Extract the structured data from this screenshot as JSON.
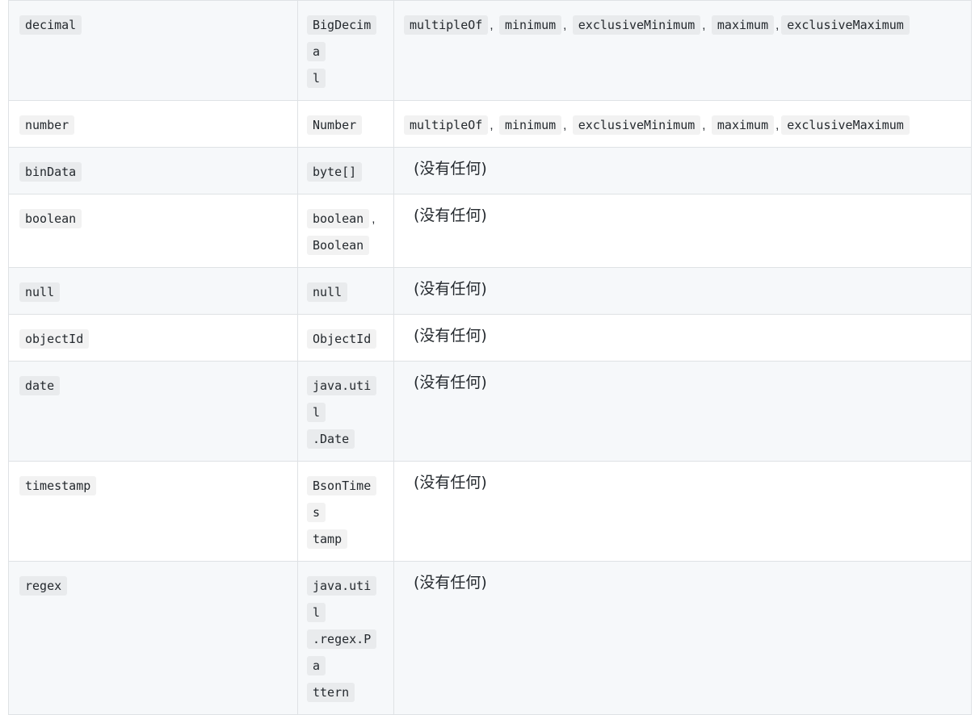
{
  "rows": [
    {
      "bson": "decimal",
      "java": "BigDecimal",
      "java_parts": [
        "BigDecima",
        "l"
      ],
      "validators": [
        "multipleOf",
        "minimum",
        "exclusiveMinimum",
        "maximum",
        "exclusiveMaximum"
      ],
      "sep": ","
    },
    {
      "bson": "number",
      "java": "Number",
      "validators": [
        "multipleOf",
        "minimum",
        "exclusiveMinimum",
        "maximum",
        "exclusiveMaximum"
      ],
      "sep": ","
    },
    {
      "bson": "binData",
      "java": "byte[]",
      "none": "(没有任何)"
    },
    {
      "bson": "boolean",
      "java_list": [
        "boolean",
        "Boolean"
      ],
      "java_sep": ",",
      "none": "(没有任何)"
    },
    {
      "bson": "null",
      "java": "null",
      "none": "(没有任何)"
    },
    {
      "bson": "objectId",
      "java": "ObjectId",
      "none": "(没有任何)"
    },
    {
      "bson": "date",
      "java": "java.util.Date",
      "java_parts": [
        "java.util",
        ".Date"
      ],
      "none": "(没有任何)"
    },
    {
      "bson": "timestamp",
      "java": "BsonTimestamp",
      "java_parts": [
        "BsonTimes",
        "tamp"
      ],
      "none": "(没有任何)"
    },
    {
      "bson": "regex",
      "java": "java.util.regex.Pattern",
      "java_parts": [
        "java.util",
        ".regex.Pa",
        "ttern"
      ],
      "none": "(没有任何)"
    }
  ]
}
